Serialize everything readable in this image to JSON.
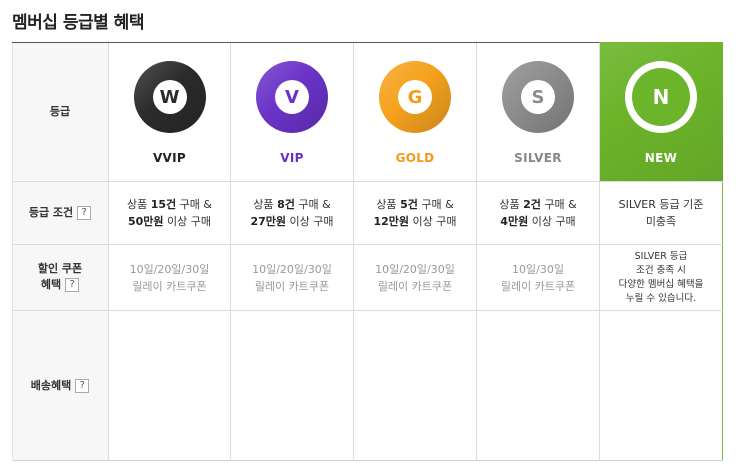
{
  "page": {
    "title": "멤버십 등급별 혜택"
  },
  "rows": {
    "grade": "등급",
    "condition": "등급 조건",
    "coupon_line1": "할인 쿠폰",
    "coupon_line2": "혜택",
    "delivery": "배송혜택",
    "help": "?"
  },
  "tiers": [
    {
      "letter": "W",
      "name": "VVIP",
      "color": "#222222",
      "badge_bg": "#2b2b2b",
      "cond_pre": "상품 ",
      "cond_count": "15건",
      "cond_mid": " 구매 &",
      "cond_amount": "50만원",
      "cond_post": " 이상 구매",
      "coupon1": "10일/20일/30일",
      "coupon2": "릴레이 카트쿠폰"
    },
    {
      "letter": "V",
      "name": "VIP",
      "color": "#6a2fc0",
      "badge_bg": "#6a33c8",
      "cond_pre": "상품 ",
      "cond_count": "8건",
      "cond_mid": " 구매 &",
      "cond_amount": "27만원",
      "cond_post": " 이상 구매",
      "coupon1": "10일/20일/30일",
      "coupon2": "릴레이 카트쿠폰"
    },
    {
      "letter": "G",
      "name": "GOLD",
      "color": "#f29a1a",
      "badge_bg": "#f5a21d",
      "cond_pre": "상품 ",
      "cond_count": "5건",
      "cond_mid": " 구매 &",
      "cond_amount": "12만원",
      "cond_post": " 이상 구매",
      "coupon1": "10일/20일/30일",
      "coupon2": "릴레이 카트쿠폰"
    },
    {
      "letter": "S",
      "name": "SILVER",
      "color": "#888888",
      "badge_bg": "#8c8c8c",
      "cond_pre": "상품 ",
      "cond_count": "2건",
      "cond_mid": " 구매 &",
      "cond_amount": "4만원",
      "cond_post": " 이상 구매",
      "coupon1": "10일/30일",
      "coupon2": "릴레이 카트쿠폰"
    }
  ],
  "new_tier": {
    "letter": "N",
    "name": "NEW",
    "accent": "#6cb42a",
    "cond1": "SILVER 등급 기준",
    "cond2": "미충족",
    "note1": "SILVER 등급",
    "note2": "조건 충족 시",
    "note3": "다양한 멤버십 혜택을",
    "note4": "누릴 수 있습니다."
  }
}
